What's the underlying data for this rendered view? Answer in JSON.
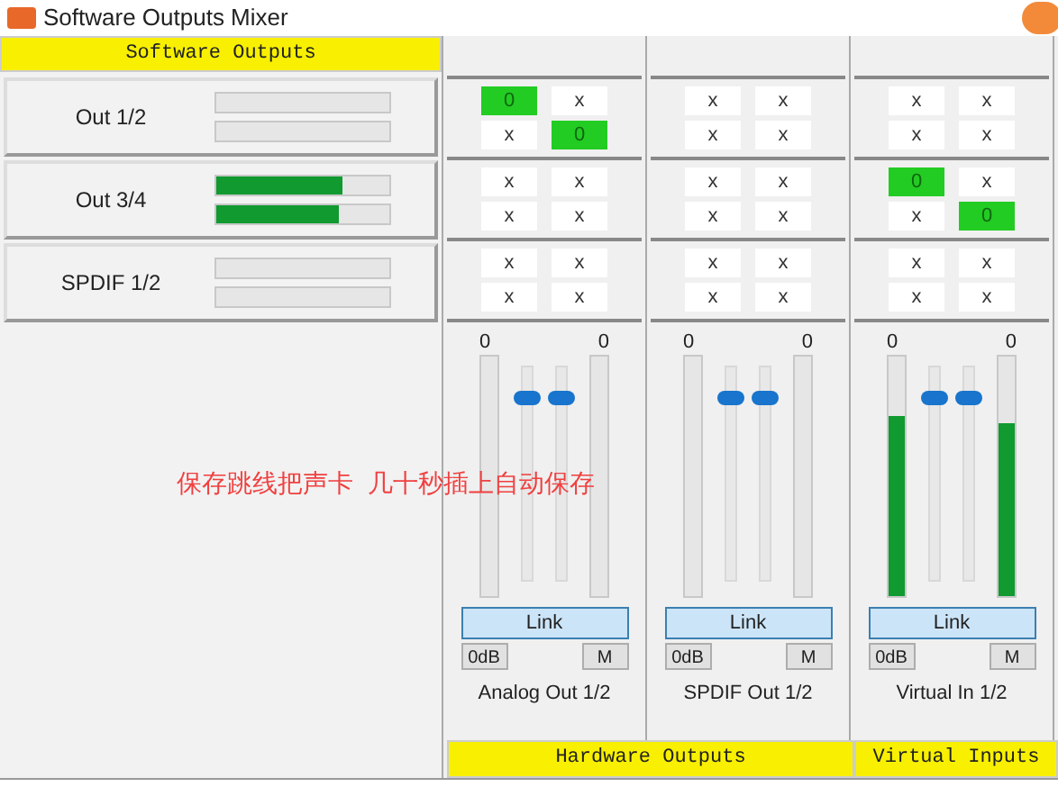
{
  "window": {
    "title": "Software Outputs Mixer"
  },
  "software_outputs": {
    "header": "Software Outputs",
    "channels": [
      {
        "name": "Out 1/2",
        "meters": [
          {
            "level": 0
          },
          {
            "level": 0
          }
        ]
      },
      {
        "name": "Out 3/4",
        "meters": [
          {
            "level": 0.73
          },
          {
            "level": 0.71
          }
        ]
      },
      {
        "name": "SPDIF 1/2",
        "meters": [
          {
            "level": 0
          },
          {
            "level": 0
          }
        ]
      }
    ]
  },
  "columns": [
    {
      "name": "Analog Out 1/2",
      "matrix": [
        [
          {
            "text": "0",
            "on": true
          },
          {
            "text": "x",
            "on": false
          },
          {
            "text": "x",
            "on": false
          },
          {
            "text": "0",
            "on": true
          }
        ],
        [
          {
            "text": "x",
            "on": false
          },
          {
            "text": "x",
            "on": false
          },
          {
            "text": "x",
            "on": false
          },
          {
            "text": "x",
            "on": false
          }
        ],
        [
          {
            "text": "x",
            "on": false
          },
          {
            "text": "x",
            "on": false
          },
          {
            "text": "x",
            "on": false
          },
          {
            "text": "x",
            "on": false
          }
        ]
      ],
      "meters": [
        {
          "reading": "0",
          "level": 0
        },
        {
          "reading": "0",
          "level": 0
        }
      ],
      "faders": [
        {
          "level": 0.88
        },
        {
          "level": 0.88
        }
      ],
      "link": "Link",
      "zero_db": "0dB",
      "mute": "M"
    },
    {
      "name": "SPDIF Out 1/2",
      "matrix": [
        [
          {
            "text": "x",
            "on": false
          },
          {
            "text": "x",
            "on": false
          },
          {
            "text": "x",
            "on": false
          },
          {
            "text": "x",
            "on": false
          }
        ],
        [
          {
            "text": "x",
            "on": false
          },
          {
            "text": "x",
            "on": false
          },
          {
            "text": "x",
            "on": false
          },
          {
            "text": "x",
            "on": false
          }
        ],
        [
          {
            "text": "x",
            "on": false
          },
          {
            "text": "x",
            "on": false
          },
          {
            "text": "x",
            "on": false
          },
          {
            "text": "x",
            "on": false
          }
        ]
      ],
      "meters": [
        {
          "reading": "0",
          "level": 0
        },
        {
          "reading": "0",
          "level": 0
        }
      ],
      "faders": [
        {
          "level": 0.88
        },
        {
          "level": 0.88
        }
      ],
      "link": "Link",
      "zero_db": "0dB",
      "mute": "M"
    },
    {
      "name": "Virtual In 1/2",
      "matrix": [
        [
          {
            "text": "x",
            "on": false
          },
          {
            "text": "x",
            "on": false
          },
          {
            "text": "x",
            "on": false
          },
          {
            "text": "x",
            "on": false
          }
        ],
        [
          {
            "text": "0",
            "on": true
          },
          {
            "text": "x",
            "on": false
          },
          {
            "text": "x",
            "on": false
          },
          {
            "text": "0",
            "on": true
          }
        ],
        [
          {
            "text": "x",
            "on": false
          },
          {
            "text": "x",
            "on": false
          },
          {
            "text": "x",
            "on": false
          },
          {
            "text": "x",
            "on": false
          }
        ]
      ],
      "meters": [
        {
          "reading": "0",
          "level": 0.75
        },
        {
          "reading": "0",
          "level": 0.72
        }
      ],
      "faders": [
        {
          "level": 0.88
        },
        {
          "level": 0.88
        }
      ],
      "link": "Link",
      "zero_db": "0dB",
      "mute": "M"
    }
  ],
  "footer": [
    {
      "label": "Hardware Outputs"
    },
    {
      "label": "Virtual Inputs"
    }
  ],
  "caption": "保存跳线把声卡  几十秒插上自动保存"
}
